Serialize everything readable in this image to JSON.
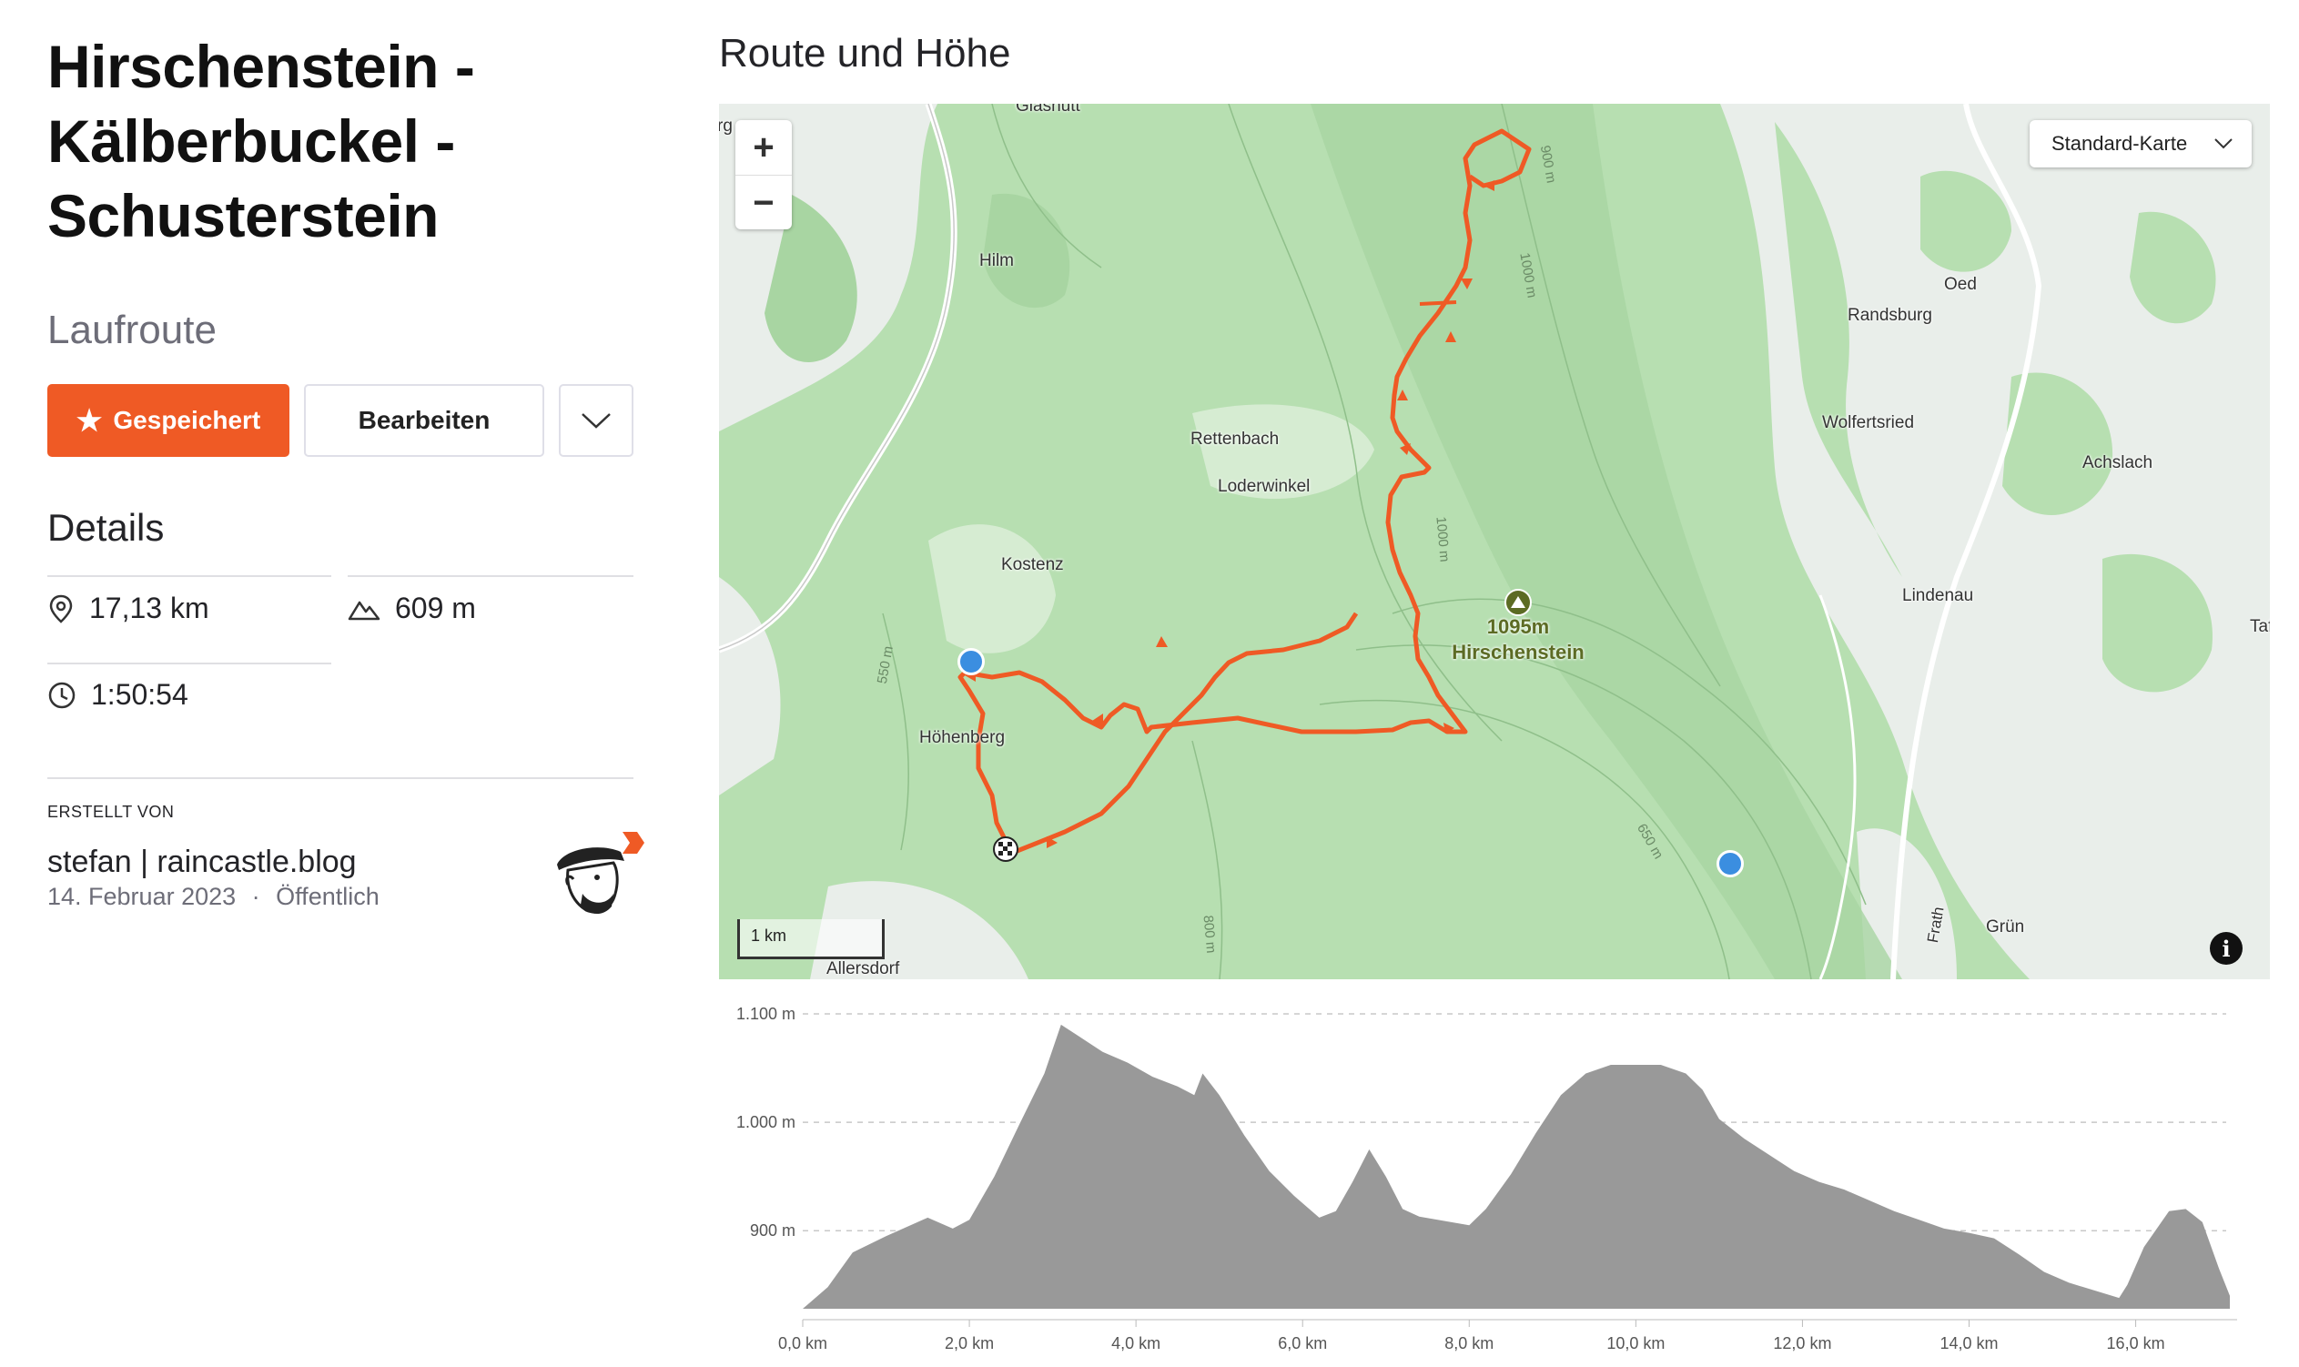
{
  "route": {
    "title": "Hirschenstein - Kälberbuckel - Schusterstein",
    "type_label": "Laufroute",
    "saved_label": "Gespeichert",
    "edit_label": "Bearbeiten",
    "details_heading": "Details",
    "distance": "17,13 km",
    "elevation_gain": "609 m",
    "duration": "1:50:54",
    "created_by_label": "ERSTELLT VON",
    "author": "stefan | raincastle.blog",
    "date": "14. Februar 2023",
    "separator": "·",
    "visibility": "Öffentlich"
  },
  "icons": {
    "saved": "star-icon",
    "more": "chevron-down-icon",
    "distance": "location-pin-icon",
    "elevation": "mountain-icon",
    "duration": "clock-icon",
    "info": "info-icon",
    "photo": "camera-icon",
    "start": "checkered-flag-icon",
    "peak": "summit-icon"
  },
  "map": {
    "heading": "Route und Höhe",
    "zoom_in": "+",
    "zoom_out": "−",
    "map_type": "Standard-Karte",
    "scale": "1 km",
    "info": "i",
    "peak_elevation": "1095m",
    "peak_name": "Hirschenstein",
    "places": [
      "Hilm",
      "Rettenbach",
      "Loderwinkel",
      "Kostenz",
      "Höhenberg",
      "Allersdorf",
      "Oed",
      "Randsburg",
      "Wolfertsried",
      "Achslach",
      "Lindenau",
      "Grün",
      "Taf"
    ],
    "contours": [
      "900 m",
      "1000 m",
      "1000 m",
      "550 m",
      "650 m",
      "800 m"
    ],
    "road_labels": [
      "Frath"
    ],
    "edge_labels": [
      "Glashütt",
      "rg"
    ],
    "route_color": "#ef5a25"
  },
  "chart_data": {
    "type": "area",
    "title": "",
    "xlabel": "",
    "ylabel": "",
    "x_ticks": [
      "0,0 km",
      "2,0 km",
      "4,0 km",
      "6,0 km",
      "8,0 km",
      "10,0 km",
      "12,0 km",
      "14,0 km",
      "16,0 km"
    ],
    "y_ticks": [
      "900 m",
      "1.000 m",
      "1.100 m"
    ],
    "xlim": [
      0,
      17.13
    ],
    "ylim": [
      828,
      1100
    ],
    "grid": true,
    "fill_color": "#999999",
    "series": [
      {
        "x": [
          0,
          0.3,
          0.6,
          1.0,
          1.5,
          1.8,
          2.0,
          2.3,
          2.6,
          2.9,
          3.1,
          3.3,
          3.6,
          3.9,
          4.2,
          4.5,
          4.7,
          4.8,
          5.0,
          5.3,
          5.6,
          5.9,
          6.2,
          6.4,
          6.6,
          6.8,
          7.0,
          7.2,
          7.4,
          7.7,
          8.0,
          8.2,
          8.5,
          8.8,
          9.1,
          9.4,
          9.7,
          10.0,
          10.3,
          10.6,
          10.8,
          11.0,
          11.3,
          11.6,
          11.9,
          12.2,
          12.5,
          12.8,
          13.1,
          13.4,
          13.7,
          14.0,
          14.3,
          14.6,
          14.9,
          15.2,
          15.5,
          15.8,
          15.9,
          16.1,
          16.4,
          16.6,
          16.8,
          17.0,
          17.13
        ],
        "y": [
          828,
          848,
          880,
          895,
          912,
          902,
          910,
          950,
          998,
          1045,
          1090,
          1080,
          1065,
          1055,
          1042,
          1033,
          1025,
          1045,
          1025,
          988,
          955,
          932,
          912,
          918,
          945,
          975,
          950,
          920,
          913,
          909,
          905,
          920,
          952,
          990,
          1025,
          1045,
          1053,
          1053,
          1053,
          1045,
          1030,
          1003,
          985,
          970,
          955,
          945,
          938,
          928,
          918,
          910,
          902,
          898,
          893,
          878,
          862,
          852,
          845,
          838,
          850,
          885,
          918,
          920,
          908,
          865,
          840
        ]
      }
    ]
  }
}
